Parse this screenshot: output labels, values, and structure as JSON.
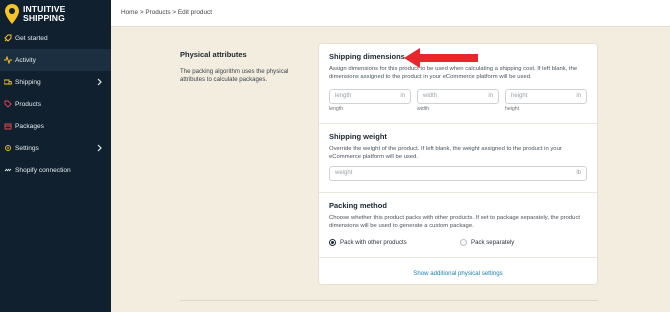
{
  "app": {
    "logo_line1": "INTUITIVE",
    "logo_line2": "SHIPPING",
    "brand_color": "#f7c325"
  },
  "sidebar": {
    "items": [
      {
        "label": "Get started",
        "icon": "rocket-icon"
      },
      {
        "label": "Activity",
        "icon": "pulse-icon",
        "active": true
      },
      {
        "label": "Shipping",
        "icon": "truck-icon",
        "chevron": true
      },
      {
        "label": "Products",
        "icon": "tag-icon"
      },
      {
        "label": "Packages",
        "icon": "box-icon"
      },
      {
        "label": "Settings",
        "icon": "gear-icon",
        "chevron": true
      },
      {
        "label": "Shopify connection",
        "icon": "link-icon"
      }
    ]
  },
  "breadcrumb": {
    "home": "Home",
    "sep1": ">",
    "products": "Products",
    "sep2": ">",
    "current": "Edit product"
  },
  "physical": {
    "title": "Physical attributes",
    "description": "The packing algorithm uses the physical attributes to calculate packages."
  },
  "dimensions": {
    "title": "Shipping dimensions",
    "description": "Assign dimensions for this product to be used when calculating a shipping cost. If left blank, the dimensions assigned to the product in your eCommerce platform will be used.",
    "fields": [
      {
        "placeholder": "length",
        "unit": "in",
        "label": "length"
      },
      {
        "placeholder": "width",
        "unit": "in",
        "label": "width"
      },
      {
        "placeholder": "height",
        "unit": "in",
        "label": "height"
      }
    ]
  },
  "weight": {
    "title": "Shipping weight",
    "description": "Override the weight of the product. If left blank, the weight assigned to the product in your eCommerce platform will be used.",
    "placeholder": "weight",
    "unit": "lb"
  },
  "packing": {
    "title": "Packing method",
    "description": "Choose whether this product packs with other products. If set to package separately, the product dimensions will be used to generate a custom package.",
    "option1": "Pack with other products",
    "option2": "Pack separately",
    "selected": "Pack with other products"
  },
  "more_link": "Show additional physical settings",
  "annotation_color": "#e8262b"
}
